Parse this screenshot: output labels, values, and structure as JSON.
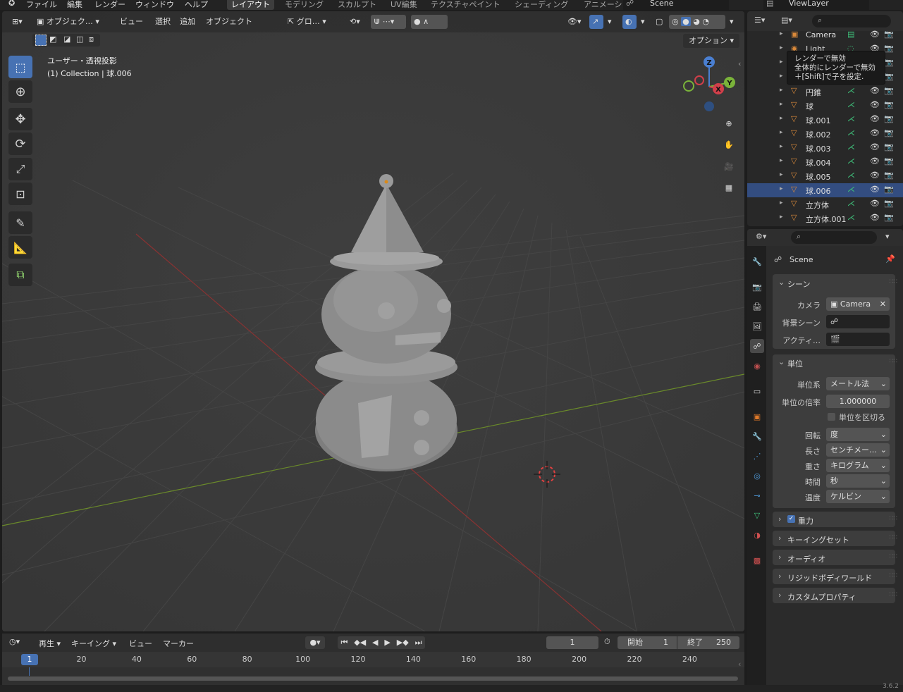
{
  "menu": [
    "ファイル",
    "編集",
    "レンダー",
    "ウィンドウ",
    "ヘルプ"
  ],
  "workspaces": [
    {
      "label": "レイアウト",
      "active": true
    },
    {
      "label": "モデリング",
      "active": false
    },
    {
      "label": "スカルプト",
      "active": false
    },
    {
      "label": "UV編集",
      "active": false
    },
    {
      "label": "テクスチャペイント",
      "active": false
    },
    {
      "label": "シェーディング",
      "active": false
    },
    {
      "label": "アニメーシ",
      "active": false
    }
  ],
  "scene_name": "Scene",
  "viewlayer_name": "ViewLayer",
  "viewport": {
    "mode": "オブジェク…",
    "menus": [
      "ビュー",
      "選択",
      "追加",
      "オブジェクト"
    ],
    "transform": "グロ…",
    "options": "オプション",
    "view_label": "ユーザー・透視投影",
    "collection_info": "(1) Collection | 球.006",
    "gizmo": {
      "z": "Z",
      "y": "Y",
      "x": "X"
    }
  },
  "outliner": {
    "items": [
      {
        "name": "Camera",
        "type": "camera"
      },
      {
        "name": "Light",
        "type": "light"
      },
      {
        "name": "",
        "type": "mesh"
      },
      {
        "name": "",
        "type": "mesh"
      },
      {
        "name": "円錐",
        "type": "mesh"
      },
      {
        "name": "球",
        "type": "mesh"
      },
      {
        "name": "球.001",
        "type": "mesh"
      },
      {
        "name": "球.002",
        "type": "mesh"
      },
      {
        "name": "球.003",
        "type": "mesh"
      },
      {
        "name": "球.004",
        "type": "mesh"
      },
      {
        "name": "球.005",
        "type": "mesh"
      },
      {
        "name": "球.006",
        "type": "mesh",
        "active": true
      },
      {
        "name": "立方体",
        "type": "mesh"
      },
      {
        "name": "立方体.001",
        "type": "mesh"
      }
    ],
    "tooltip": [
      "レンダーで無効",
      "全体的にレンダーで無効",
      "＋[Shift]で子を設定."
    ]
  },
  "properties": {
    "context": "Scene",
    "scene_panel": {
      "title": "シーン",
      "camera_label": "カメラ",
      "camera_value": "Camera",
      "bg_label": "背景シーン",
      "active_label": "アクティ…"
    },
    "units_panel": {
      "title": "単位",
      "system_label": "単位系",
      "system_value": "メートル法",
      "scale_label": "単位の倍率",
      "scale_value": "1.000000",
      "separate_label": "単位を区切る",
      "rotation_label": "回転",
      "rotation_value": "度",
      "length_label": "長さ",
      "length_value": "センチメー…",
      "mass_label": "重さ",
      "mass_value": "キログラム",
      "time_label": "時間",
      "time_value": "秒",
      "temp_label": "温度",
      "temp_value": "ケルビン"
    },
    "collapsed": [
      "重力",
      "キーイングセット",
      "オーディオ",
      "リジッドボディワールド",
      "カスタムプロパティ"
    ]
  },
  "timeline": {
    "play_label": "再生",
    "keying_label": "キーイング",
    "view_label": "ビュー",
    "marker_label": "マーカー",
    "current_frame": "1",
    "start_label": "開始",
    "start_value": "1",
    "end_label": "終了",
    "end_value": "250",
    "ticks": [
      "20",
      "40",
      "60",
      "80",
      "100",
      "120",
      "140",
      "160",
      "180",
      "200",
      "220",
      "240"
    ],
    "current_marker": "1"
  },
  "version": "3.6.2"
}
